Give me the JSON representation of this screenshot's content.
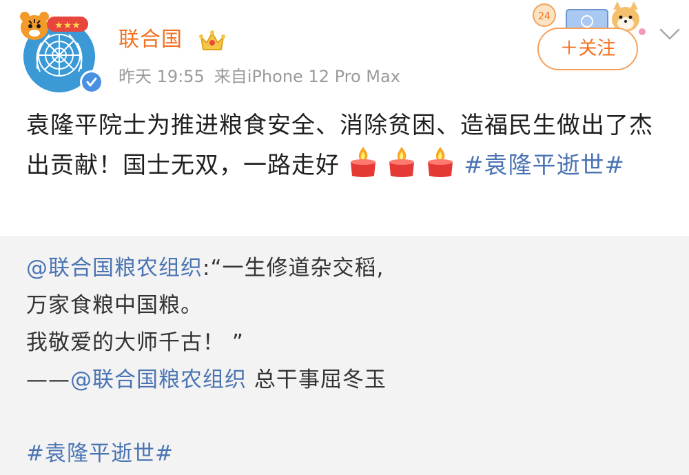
{
  "author": {
    "name": "联合国",
    "avatar_icon": "un-emblem-icon",
    "pendant_icon": "tiger-pendant-icon",
    "crown_icon": "crown-icon",
    "verified_icon": "verified-badge-icon"
  },
  "post": {
    "time": "昨天 19:55",
    "source": "来自iPhone 12 Pro Max",
    "text_part1": "袁隆平院士为推进粮食安全、消除贫困、造福民生做出了杰出贡献！国士无双，一路走好",
    "candle_icons": [
      "candle-icon",
      "candle-icon",
      "candle-icon"
    ],
    "hashtag": "#袁隆平逝世#"
  },
  "actions": {
    "follow_label": "＋关注",
    "menu_icon": "chevron-down-icon"
  },
  "repost": {
    "mention": "@联合国粮农组织",
    "line1_rest": ":“一生修道杂交稻,",
    "line2": "万家食粮中国粮。",
    "line3": "我敬爱的大师千古！ ”",
    "line4_prefix": "——",
    "line4_mention": "@联合国粮农组织",
    "line4_rest": " 总干事屈冬玉",
    "hashtag": "#袁隆平逝世#"
  },
  "colors": {
    "name_orange": "#f2701f",
    "link_blue": "#4b74b3",
    "meta_gray": "#9a9a9a",
    "repost_bg": "#f3f3f3"
  }
}
